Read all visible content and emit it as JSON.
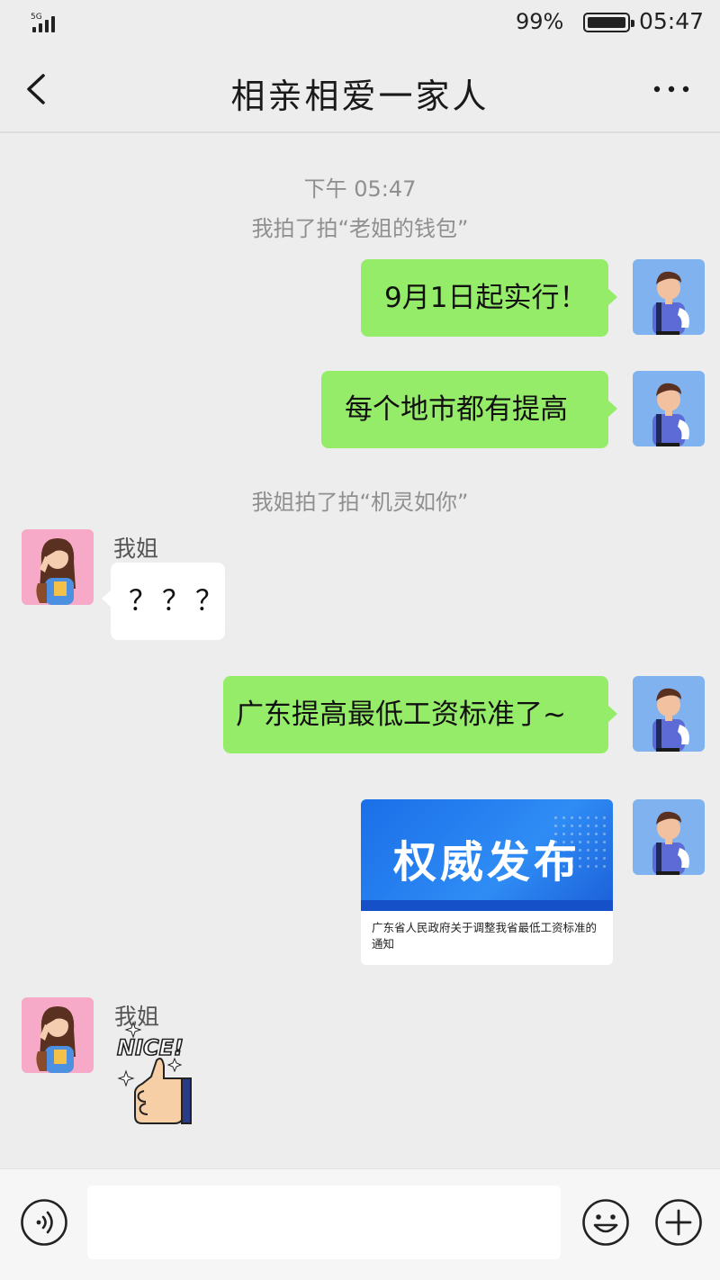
{
  "status_bar": {
    "network": "5G",
    "battery_percent": "99%",
    "battery_level": 0.99,
    "time": "05:47"
  },
  "header": {
    "title": "相亲相爱一家人",
    "back_icon": "chevron-left-icon",
    "more_icon": "more-dots-icon"
  },
  "chat": {
    "timestamp": "下午 05:47",
    "pat1": "我拍了拍“老姐的钱包”",
    "msg1": "9月1日起实行！",
    "msg2": "每个地市都有提高",
    "pat2": "我姐拍了拍“机灵如你”",
    "sender1": "我姐",
    "msg3": "？？？",
    "msg4": "广东提高最低工资标准了~",
    "card": {
      "banner_heading": "权威发布",
      "description": "广东省人民政府关于调整我省最低工资标准的通知"
    },
    "sender2": "我姐",
    "sticker_text": "NICE!"
  },
  "input_bar": {
    "voice_icon": "voice-icon",
    "text_value": "",
    "emoji_icon": "emoji-icon",
    "plus_icon": "plus-icon"
  },
  "colors": {
    "background": "#ededed",
    "outgoing_bubble": "#95ec69",
    "incoming_bubble": "#ffffff",
    "system_text": "#8f8f8f",
    "card_banner": "#2f8cf5"
  }
}
